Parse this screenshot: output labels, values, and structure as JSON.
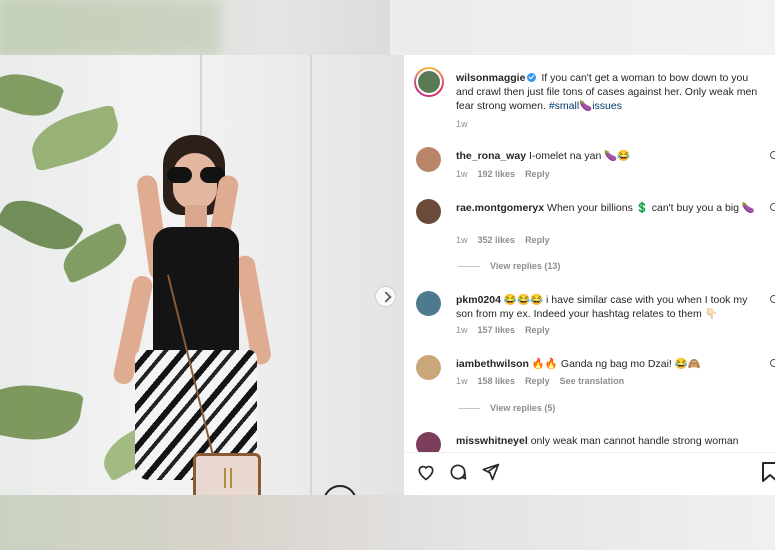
{
  "post": {
    "username": "wilsonmaggie",
    "caption_text": "If you can't get a woman to bow down to you and crawl then just file tons of cases against her. Only weak men fear strong women.",
    "caption_tag": "#small🍆issues",
    "time": "1w"
  },
  "comments": [
    {
      "user": "the_rona_way",
      "text": "I-omelet na yan 🍆😂",
      "time": "1w",
      "likes": "192 likes",
      "reply": "Reply",
      "avatar_color": "#b7866a"
    },
    {
      "user": "rae.montgomeryx",
      "text": "When your billions 💲 can't buy you a big 🍆",
      "time": "1w",
      "likes": "352 likes",
      "reply": "Reply",
      "avatar_color": "#6a4b3a",
      "view_replies": "View replies (13)"
    },
    {
      "user": "pkm0204",
      "text": "😂😂😂 i have similar case with you when I took my son from my ex. Indeed your hashtag relates to them 👇🏻",
      "time": "1w",
      "likes": "157 likes",
      "reply": "Reply",
      "avatar_color": "#4d7a8f"
    },
    {
      "user": "iambethwilson",
      "text": "🔥🔥 Ganda ng bag mo Dzai! 😂🙈",
      "time": "1w",
      "likes": "158 likes",
      "reply": "Reply",
      "translation": "See translation",
      "avatar_color": "#c9a77a",
      "view_replies": "View replies (5)"
    },
    {
      "user": "misswhitneyel",
      "text": "only weak man cannot handle strong woman",
      "avatar_color": "#7a3d5a"
    }
  ],
  "icons": [
    "heart-icon",
    "comment-icon",
    "share-icon",
    "save-icon",
    "next-arrow-icon",
    "verified-icon"
  ],
  "colors": {
    "link": "#00376b",
    "verified": "#3897f0",
    "meta": "#8e8e8e"
  }
}
